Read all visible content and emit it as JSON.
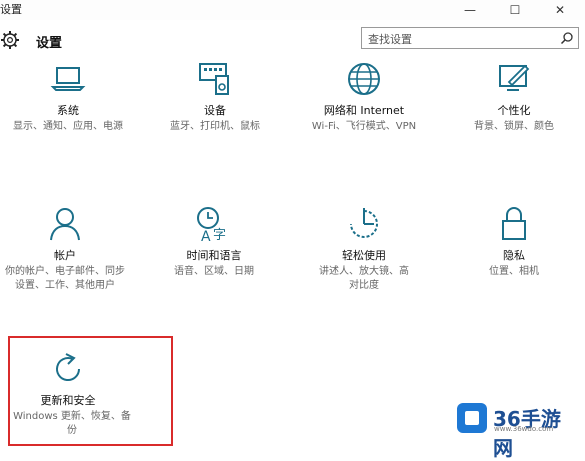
{
  "window": {
    "title": "设置",
    "min_label": "—",
    "max_label": "☐",
    "close_label": "✕"
  },
  "header": {
    "app_title": "设置",
    "search_placeholder": "查找设置"
  },
  "tiles": [
    {
      "name": "系统",
      "desc": "显示、通知、应用、电源",
      "icon": "laptop-icon"
    },
    {
      "name": "设备",
      "desc": "蓝牙、打印机、鼠标",
      "icon": "devices-icon"
    },
    {
      "name": "网络和 Internet",
      "desc": "Wi-Fi、飞行模式、VPN",
      "icon": "globe-icon"
    },
    {
      "name": "个性化",
      "desc": "背景、锁屏、颜色",
      "icon": "personalize-icon"
    },
    {
      "name": "帐户",
      "desc": "你的帐户、电子邮件、同步设置、工作、其他用户",
      "icon": "account-icon"
    },
    {
      "name": "时间和语言",
      "desc": "语音、区域、日期",
      "icon": "time-language-icon"
    },
    {
      "name": "轻松使用",
      "desc": "讲述人、放大镜、高对比度",
      "icon": "ease-of-access-icon"
    },
    {
      "name": "隐私",
      "desc": "位置、相机",
      "icon": "lock-icon"
    },
    {
      "name": "更新和安全",
      "desc": "Windows 更新、恢复、备份",
      "icon": "update-icon"
    }
  ],
  "watermark": {
    "brand": "36手游网",
    "url": "www.36wdo.com"
  },
  "colors": {
    "icon": "#1b6f8a",
    "highlight": "#d92b2b"
  }
}
